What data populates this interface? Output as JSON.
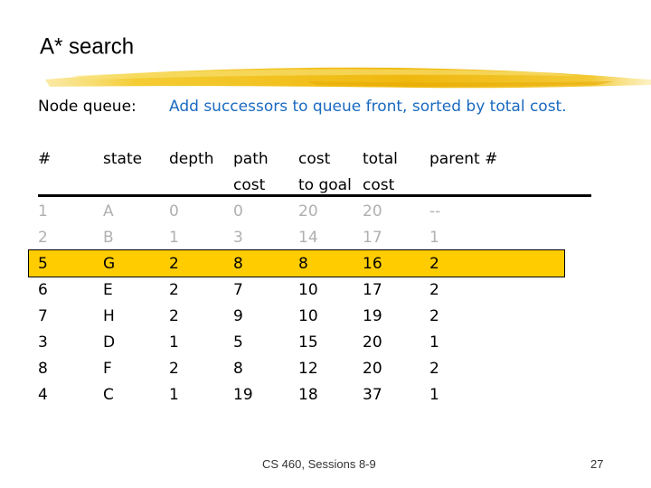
{
  "slide": {
    "title": "A* search",
    "subtitle_label": "Node queue:",
    "subtitle_text": "Add successors to queue front, sorted by total cost.",
    "footer": "CS 460,  Sessions 8-9",
    "page_number": "27",
    "colors": {
      "highlight": "#ffcc00",
      "subtitle_text": "#1a6ac0",
      "dim_row_text": "#b0b0b0",
      "brush_stroke": "#f2c21a"
    }
  },
  "table": {
    "headers": [
      {
        "line1": "#",
        "line2": ""
      },
      {
        "line1": "state",
        "line2": ""
      },
      {
        "line1": "depth",
        "line2": ""
      },
      {
        "line1": "path",
        "line2": "cost"
      },
      {
        "line1": "cost",
        "line2": "to goal"
      },
      {
        "line1": "total",
        "line2": "cost"
      },
      {
        "line1": "parent #",
        "line2": ""
      }
    ],
    "rows": [
      {
        "cells": [
          "1",
          "A",
          "0",
          "0",
          "20",
          "20",
          "--"
        ],
        "style": "dim"
      },
      {
        "cells": [
          "2",
          "B",
          "1",
          "3",
          "14",
          "17",
          "1"
        ],
        "style": "dim"
      },
      {
        "cells": [
          "5",
          "G",
          "2",
          "8",
          "8",
          "16",
          "2"
        ],
        "style": "highlighted"
      },
      {
        "cells": [
          "6",
          "E",
          "2",
          "7",
          "10",
          "17",
          "2"
        ],
        "style": "normal"
      },
      {
        "cells": [
          "7",
          "H",
          "2",
          "9",
          "10",
          "19",
          "2"
        ],
        "style": "normal"
      },
      {
        "cells": [
          "3",
          "D",
          "1",
          "5",
          "15",
          "20",
          "1"
        ],
        "style": "normal"
      },
      {
        "cells": [
          "8",
          "F",
          "2",
          "8",
          "12",
          "20",
          "2"
        ],
        "style": "normal"
      },
      {
        "cells": [
          "4",
          "C",
          "1",
          "19",
          "18",
          "37",
          "1"
        ],
        "style": "normal"
      }
    ]
  }
}
